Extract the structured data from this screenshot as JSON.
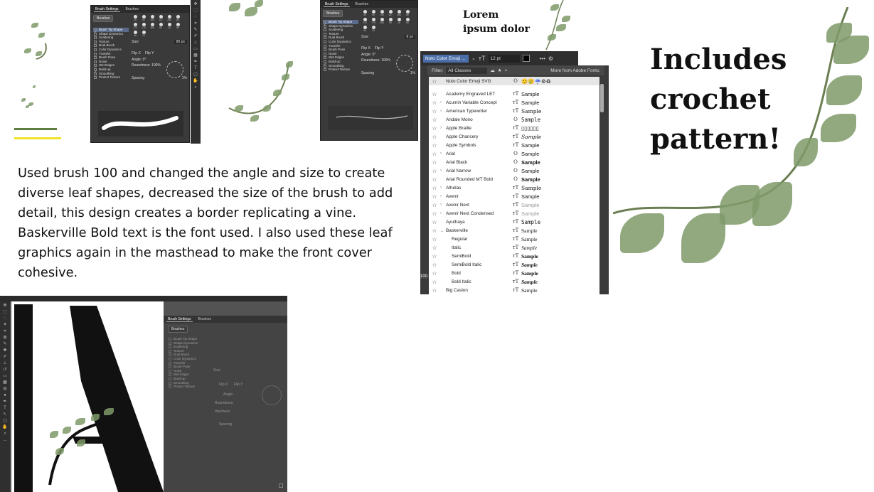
{
  "description": "Used brush 100 and changed the angle and size to create diverse leaf shapes, decreased the size of the brush to add detail, this design creates a border replicating a vine. Baskerville Bold text is the font used. I also used these leaf graphics again in the masthead to make the front cover cohesive.",
  "lorem": {
    "line1": "Lorem",
    "line2": "ipsum dolor"
  },
  "crochet": {
    "line1": "Includes",
    "line2": "crochet",
    "line3": "pattern!"
  },
  "brush_panel": {
    "tab_settings": "Brush Settings",
    "tab_brushes": "Brushes",
    "brushes_button": "Brushes",
    "items": [
      "Brush Tip Shape",
      "Shape Dynamics",
      "Scattering",
      "Texture",
      "Dual Brush",
      "Color Dynamics",
      "Transfer",
      "Brush Pose",
      "Noise",
      "Wet Edges",
      "Build-up",
      "Smoothing",
      "Protect Texture"
    ],
    "brush_sizes": [
      "30",
      "60",
      "100",
      "127",
      "284",
      "80",
      "174",
      "175",
      "306",
      "50",
      "16",
      "60",
      "36",
      "33"
    ],
    "size_label": "Size",
    "size_value_1": "80 px",
    "size_value_2": "8 px",
    "flip_x": "Flip X",
    "flip_y": "Flip Y",
    "angle_label": "Angle:",
    "angle_value": "0°",
    "roundness_label": "Roundness:",
    "roundness_value": "100%",
    "hardness_label": "Hardness",
    "spacing_label": "Spacing",
    "spacing_value": "1%"
  },
  "font_panel": {
    "current_font": "Noto Color Emoji ...",
    "font_size": "12 pt",
    "filter_label": "Filter:",
    "filter_value": "All Classes",
    "more_fonts": "More from Adobe Fonts:",
    "top_font": "Noto Color Emoji SVG",
    "zoom": "100",
    "fonts": [
      {
        "name": "Academy Engraved LET",
        "sample": "Sample",
        "caret": ""
      },
      {
        "name": "Acumin Variable Concept",
        "sample": "Sample",
        "caret": "›"
      },
      {
        "name": "American Typewriter",
        "sample": "Sample",
        "caret": "›"
      },
      {
        "name": "Andale Mono",
        "sample": "Sample",
        "caret": ""
      },
      {
        "name": "Apple Braille",
        "sample": "▯▯▯▯▯▯",
        "caret": "›"
      },
      {
        "name": "Apple Chancery",
        "sample": "Sample",
        "caret": ""
      },
      {
        "name": "Apple Symbols",
        "sample": "Sample",
        "caret": ""
      },
      {
        "name": "Arial",
        "sample": "Sample",
        "caret": "›"
      },
      {
        "name": "Arial Black",
        "sample": "Sample",
        "caret": ""
      },
      {
        "name": "Arial Narrow",
        "sample": "Sample",
        "caret": "›"
      },
      {
        "name": "Arial Rounded MT Bold",
        "sample": "Sample",
        "caret": ""
      },
      {
        "name": "Athelas",
        "sample": "Sample",
        "caret": "›"
      },
      {
        "name": "Avenir",
        "sample": "Sample",
        "caret": "›"
      },
      {
        "name": "Avenir Next",
        "sample": "Sample",
        "caret": "›"
      },
      {
        "name": "Avenir Next Condensed",
        "sample": "Sample",
        "caret": "›"
      },
      {
        "name": "Ayuthaya",
        "sample": "Sample",
        "caret": ""
      },
      {
        "name": "Baskerville",
        "sample": "Sample",
        "caret": "⌄"
      },
      {
        "name": "Regular",
        "sample": "Sample",
        "caret": ""
      },
      {
        "name": "Italic",
        "sample": "Sample",
        "caret": ""
      },
      {
        "name": "SemiBold",
        "sample": "Sample",
        "caret": ""
      },
      {
        "name": "SemiBold Italic",
        "sample": "Sample",
        "caret": ""
      },
      {
        "name": "Bold",
        "sample": "Sample",
        "caret": ""
      },
      {
        "name": "Bold Italic",
        "sample": "Sample",
        "caret": ""
      },
      {
        "name": "Big Caslon",
        "sample": "Sample",
        "caret": ""
      }
    ]
  },
  "colors": {
    "panel_dark": "#3a3a3a",
    "leaf_green": "#7f9a6a",
    "line_green": "#5e7d3e",
    "line_yellow": "#f2e22a",
    "selected_blue": "#4b6ea9"
  }
}
